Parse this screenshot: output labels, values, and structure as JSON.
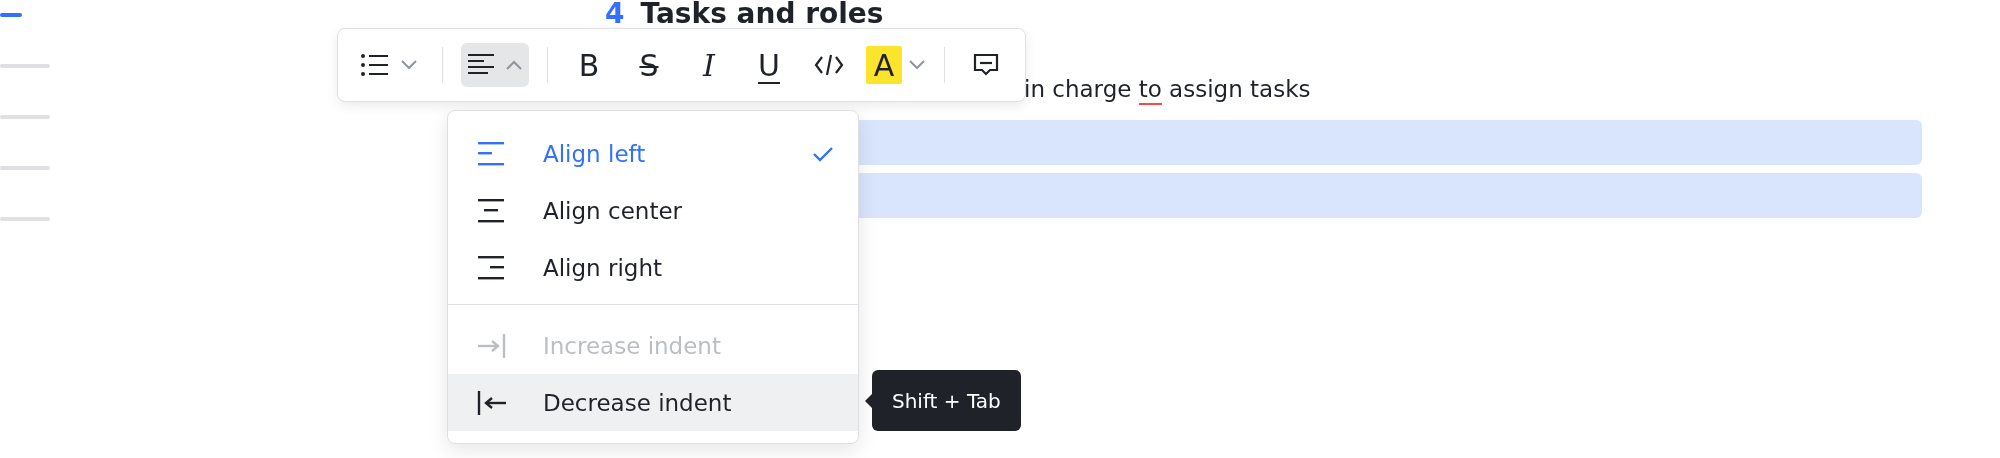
{
  "outline": [
    {
      "selected": true
    },
    {
      "selected": false
    },
    {
      "selected": false
    },
    {
      "selected": false
    },
    {
      "selected": false
    }
  ],
  "heading": {
    "number": "4",
    "title": "Tasks and roles"
  },
  "paragraph": [
    {
      "text": "in charge ",
      "misspelled": false
    },
    {
      "text": "to",
      "misspelled": true
    },
    {
      "text": " assign tasks",
      "misspelled": false
    }
  ],
  "blocks": [
    {
      "selected": true
    },
    {
      "selected": true
    }
  ],
  "toolbar": [
    {
      "kind": "list",
      "selected": false
    },
    {
      "kind": "divider"
    },
    {
      "kind": "align",
      "selected": true
    },
    {
      "kind": "divider"
    },
    {
      "kind": "bold",
      "label": "B",
      "selected": false
    },
    {
      "kind": "strike",
      "label": "S",
      "selected": false
    },
    {
      "kind": "italic",
      "label": "I",
      "selected": false
    },
    {
      "kind": "underline",
      "label": "U",
      "selected": false
    },
    {
      "kind": "code",
      "selected": false
    },
    {
      "kind": "highlight",
      "label": "A",
      "selected": false
    },
    {
      "kind": "divider"
    },
    {
      "kind": "comment",
      "selected": false
    }
  ],
  "menu": {
    "groups": [
      [
        {
          "kind": "align-left",
          "label": "Align left",
          "selected": true,
          "disabled": false,
          "highlighted": false
        },
        {
          "kind": "align-center",
          "label": "Align center",
          "selected": false,
          "disabled": false,
          "highlighted": false
        },
        {
          "kind": "align-right",
          "label": "Align right",
          "selected": false,
          "disabled": false,
          "highlighted": false
        }
      ],
      [
        {
          "kind": "indent",
          "label": "Increase indent",
          "selected": false,
          "disabled": true,
          "highlighted": false
        },
        {
          "kind": "outdent",
          "label": "Decrease indent",
          "selected": false,
          "disabled": false,
          "highlighted": true
        }
      ]
    ]
  },
  "tooltip": {
    "text": "Shift + Tab"
  }
}
